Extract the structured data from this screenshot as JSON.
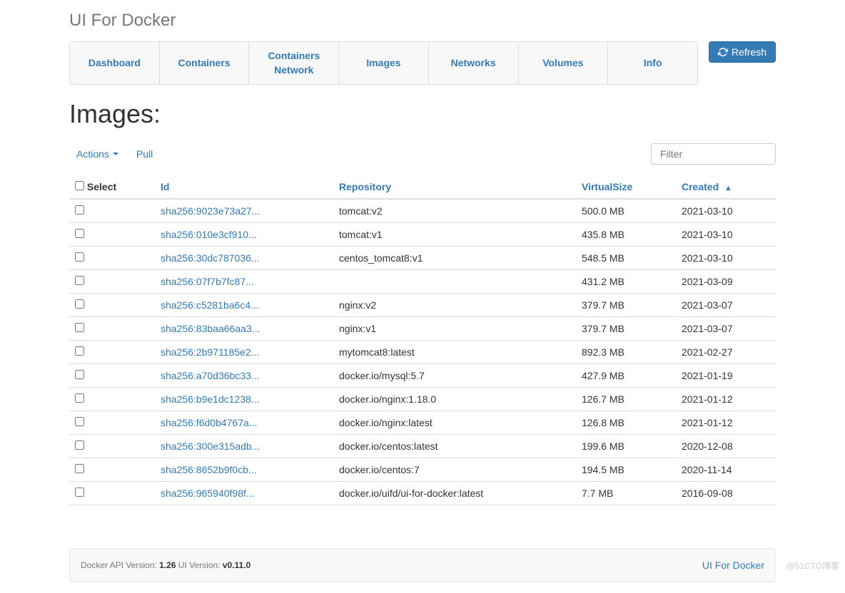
{
  "app_title": "UI For Docker",
  "nav": {
    "tabs": [
      "Dashboard",
      "Containers",
      "Containers Network",
      "Images",
      "Networks",
      "Volumes",
      "Info"
    ],
    "refresh_label": "Refresh"
  },
  "page_title": "Images:",
  "actions": {
    "actions_label": "Actions",
    "pull_label": "Pull"
  },
  "filter_placeholder": "Filter",
  "table": {
    "headers": {
      "select": "Select",
      "id": "Id",
      "repository": "Repository",
      "virtual_size": "VirtualSize",
      "created": "Created"
    },
    "rows": [
      {
        "id": "sha256:9023e73a27...",
        "repository": "tomcat:v2",
        "size": "500.0 MB",
        "created": "2021-03-10"
      },
      {
        "id": "sha256:010e3cf910...",
        "repository": "tomcat:v1",
        "size": "435.8 MB",
        "created": "2021-03-10"
      },
      {
        "id": "sha256:30dc787036...",
        "repository": "centos_tomcat8:v1",
        "size": "548.5 MB",
        "created": "2021-03-10"
      },
      {
        "id": "sha256:07f7b7fc87...",
        "repository": "",
        "size": "431.2 MB",
        "created": "2021-03-09"
      },
      {
        "id": "sha256:c5281ba6c4...",
        "repository": "nginx:v2",
        "size": "379.7 MB",
        "created": "2021-03-07"
      },
      {
        "id": "sha256:83baa66aa3...",
        "repository": "nginx:v1",
        "size": "379.7 MB",
        "created": "2021-03-07"
      },
      {
        "id": "sha256:2b971185e2...",
        "repository": "mytomcat8:latest",
        "size": "892.3 MB",
        "created": "2021-02-27"
      },
      {
        "id": "sha256:a70d36bc33...",
        "repository": "docker.io/mysql:5.7",
        "size": "427.9 MB",
        "created": "2021-01-19"
      },
      {
        "id": "sha256:b9e1dc1238...",
        "repository": "docker.io/nginx:1.18.0",
        "size": "126.7 MB",
        "created": "2021-01-12"
      },
      {
        "id": "sha256:f6d0b4767a...",
        "repository": "docker.io/nginx:latest",
        "size": "126.8 MB",
        "created": "2021-01-12"
      },
      {
        "id": "sha256:300e315adb...",
        "repository": "docker.io/centos:latest",
        "size": "199.6 MB",
        "created": "2020-12-08"
      },
      {
        "id": "sha256:8652b9f0cb...",
        "repository": "docker.io/centos:7",
        "size": "194.5 MB",
        "created": "2020-11-14"
      },
      {
        "id": "sha256:965940f98f...",
        "repository": "docker.io/uifd/ui-for-docker:latest",
        "size": "7.7 MB",
        "created": "2016-09-08"
      }
    ]
  },
  "footer": {
    "api_label": "Docker API Version: ",
    "api_version": "1.26",
    "ui_label": " UI Version: ",
    "ui_version": "v0.11.0",
    "link_label": "UI For Docker"
  },
  "watermark": "@51CTO博客"
}
